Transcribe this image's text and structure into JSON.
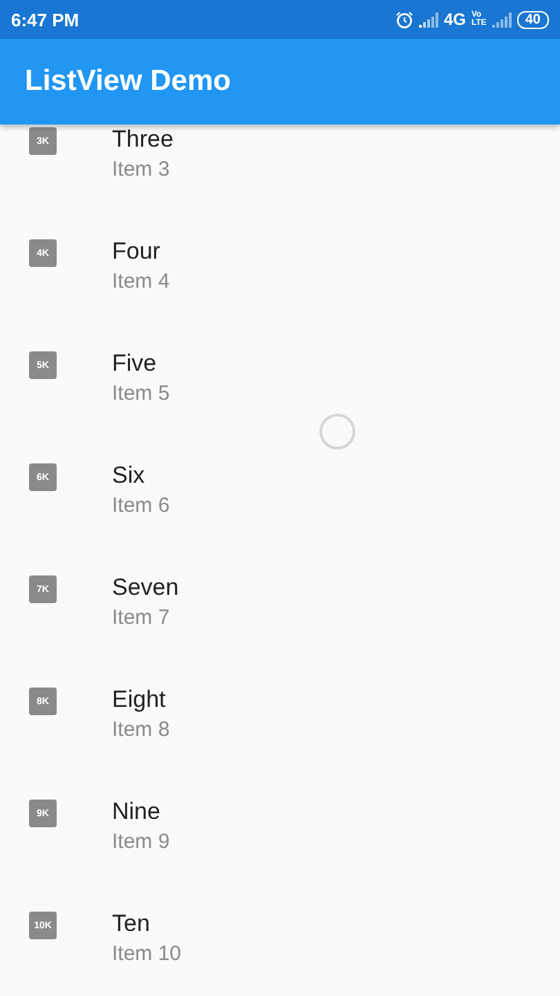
{
  "status_bar": {
    "time": "6:47 PM",
    "network": "4G",
    "volte": [
      "Vo",
      "LTE"
    ],
    "battery": "40"
  },
  "app_bar": {
    "title": "ListView Demo"
  },
  "items": [
    {
      "icon": "3K",
      "title": "Three",
      "subtitle": "Item 3"
    },
    {
      "icon": "4K",
      "title": "Four",
      "subtitle": "Item 4"
    },
    {
      "icon": "5K",
      "title": "Five",
      "subtitle": "Item 5"
    },
    {
      "icon": "6K",
      "title": "Six",
      "subtitle": "Item 6"
    },
    {
      "icon": "7K",
      "title": "Seven",
      "subtitle": "Item 7"
    },
    {
      "icon": "8K",
      "title": "Eight",
      "subtitle": "Item 8"
    },
    {
      "icon": "9K",
      "title": "Nine",
      "subtitle": "Item 9"
    },
    {
      "icon": "10K",
      "title": "Ten",
      "subtitle": "Item 10"
    }
  ]
}
